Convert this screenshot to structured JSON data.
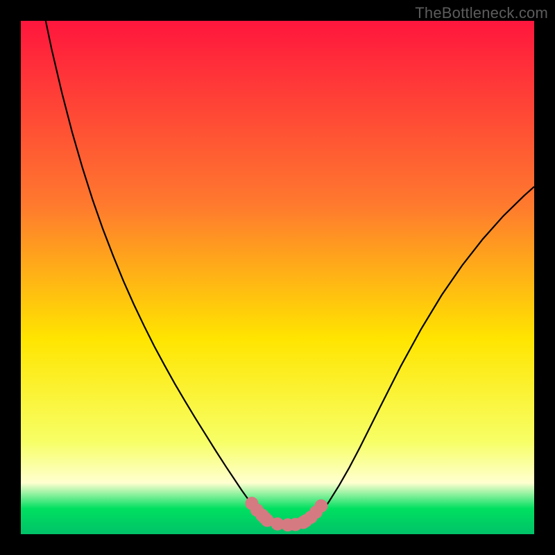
{
  "watermark": "TheBottleneck.com",
  "colors": {
    "frame": "#000000",
    "curve_stroke": "#000000",
    "marker_fill": "#d67a82",
    "marker_stroke": "#d67a82",
    "grad_top": "#ff163d",
    "grad_mid1": "#ff7a2e",
    "grad_mid2": "#ffe500",
    "grad_mid3": "#f7ff66",
    "grad_band_pale": "#ffffd0",
    "grad_green": "#00e060",
    "grad_bottom": "#00c268"
  },
  "chart_data": {
    "type": "line",
    "title": "",
    "xlabel": "",
    "ylabel": "",
    "xlim": [
      0,
      100
    ],
    "ylim": [
      0,
      100
    ],
    "curve": {
      "name": "bottleneck-curve",
      "x_norm": [
        0.0,
        0.02,
        0.04,
        0.06,
        0.08,
        0.1,
        0.12,
        0.14,
        0.16,
        0.18,
        0.2,
        0.22,
        0.24,
        0.26,
        0.28,
        0.3,
        0.32,
        0.34,
        0.36,
        0.38,
        0.4,
        0.41,
        0.42,
        0.43,
        0.44,
        0.45,
        0.46,
        0.47,
        0.48,
        0.49,
        0.5,
        0.51,
        0.52,
        0.53,
        0.54,
        0.55,
        0.56,
        0.57,
        0.58,
        0.59,
        0.6,
        0.62,
        0.64,
        0.66,
        0.68,
        0.7,
        0.74,
        0.78,
        0.82,
        0.86,
        0.9,
        0.94,
        0.98,
        1.0
      ],
      "y_norm": [
        1.26,
        1.145,
        1.04,
        0.945,
        0.86,
        0.783,
        0.714,
        0.651,
        0.594,
        0.542,
        0.493,
        0.448,
        0.406,
        0.366,
        0.329,
        0.293,
        0.259,
        0.226,
        0.194,
        0.162,
        0.131,
        0.116,
        0.101,
        0.086,
        0.072,
        0.058,
        0.046,
        0.035,
        0.026,
        0.019,
        0.015,
        0.013,
        0.012,
        0.012,
        0.013,
        0.016,
        0.021,
        0.028,
        0.037,
        0.049,
        0.063,
        0.095,
        0.13,
        0.168,
        0.208,
        0.248,
        0.327,
        0.4,
        0.466,
        0.524,
        0.575,
        0.62,
        0.659,
        0.677
      ]
    },
    "markers": {
      "name": "bottom-band",
      "x_norm": [
        0.45,
        0.46,
        0.47,
        0.475,
        0.48,
        0.5,
        0.52,
        0.535,
        0.55,
        0.555,
        0.565,
        0.575,
        0.585
      ],
      "y_norm": [
        0.06,
        0.047,
        0.037,
        0.032,
        0.027,
        0.02,
        0.018,
        0.019,
        0.023,
        0.026,
        0.033,
        0.043,
        0.055
      ]
    },
    "gradient_stops": [
      {
        "offset": 0.0,
        "key": "grad_top"
      },
      {
        "offset": 0.36,
        "key": "grad_mid1"
      },
      {
        "offset": 0.62,
        "key": "grad_mid2"
      },
      {
        "offset": 0.82,
        "key": "grad_mid3"
      },
      {
        "offset": 0.9,
        "key": "grad_band_pale"
      },
      {
        "offset": 0.95,
        "key": "grad_green"
      },
      {
        "offset": 1.0,
        "key": "grad_bottom"
      }
    ]
  }
}
